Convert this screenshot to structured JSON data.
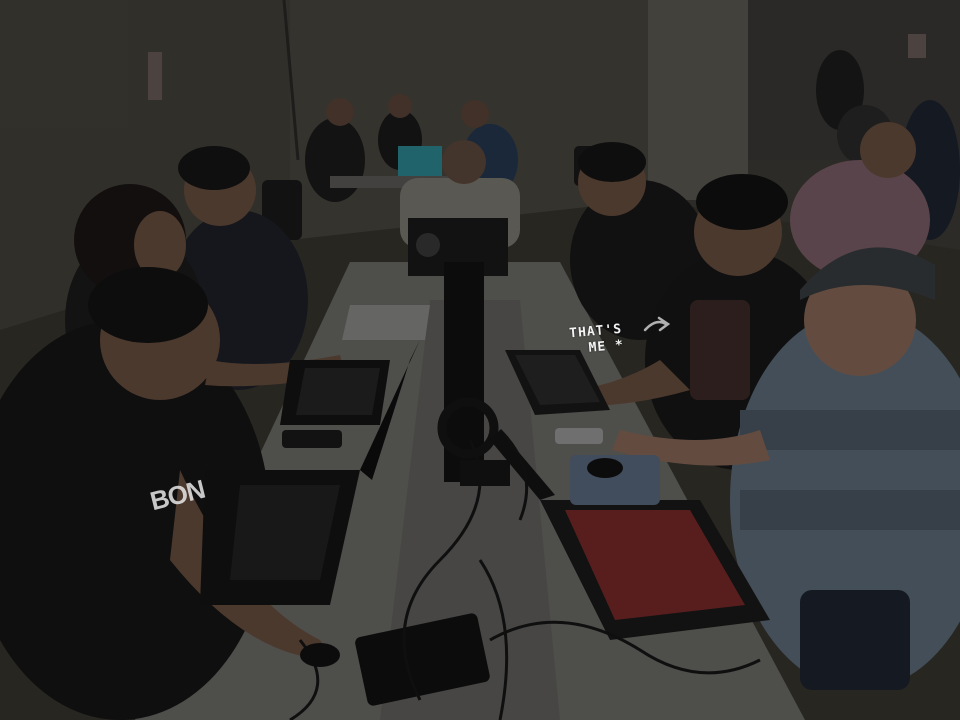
{
  "photo": {
    "annotation": {
      "line1": "THAT'S",
      "line2": "ME *"
    },
    "shirt_print": "BON",
    "colors": {
      "background": "#3f3c36",
      "wall": "#4a4740",
      "pillar": "#5c5a54",
      "table": "#6d6c69",
      "laptop_dark": "#141414",
      "keyboard_red": "#7a2a2a",
      "shirt_gray_blue": "#5f6d7c",
      "shirt_plaid": "#7d5f68",
      "overlay_dim": "rgba(0,0,0,0.28)"
    }
  }
}
